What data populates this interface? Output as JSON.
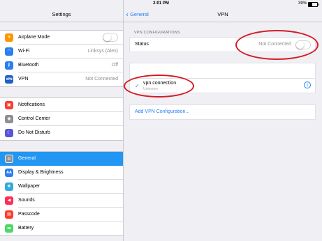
{
  "status_bar": {
    "device": "iPad",
    "time": "2:01 PM",
    "battery": "39%",
    "battery_level": 0.39
  },
  "settings": {
    "title": "Settings",
    "groups": [
      [
        {
          "id": "airplane",
          "label": "Airplane Mode",
          "value": "",
          "toggle": true,
          "icon": "airplane-icon",
          "glyph": "✈",
          "color": "#ff9500"
        },
        {
          "id": "wifi",
          "label": "Wi-Fi",
          "value": "Linksys (Alex)",
          "icon": "wifi-icon",
          "glyph": "◠",
          "color": "#2a7ef2"
        },
        {
          "id": "bluetooth",
          "label": "Bluetooth",
          "value": "Off",
          "icon": "bluetooth-icon",
          "glyph": "ᛒ",
          "color": "#2a7ef2"
        },
        {
          "id": "vpn",
          "label": "VPN",
          "value": "Not Connected",
          "icon": "vpn-icon",
          "glyph": "VPN",
          "color": "#1e5fc6"
        }
      ],
      [
        {
          "id": "notifications",
          "label": "Notifications",
          "value": "",
          "icon": "notifications-icon",
          "glyph": "▣",
          "color": "#ff3b30"
        },
        {
          "id": "control-center",
          "label": "Control Center",
          "value": "",
          "icon": "control-center-icon",
          "glyph": "◉",
          "color": "#8e8e93"
        },
        {
          "id": "do-not-disturb",
          "label": "Do Not Disturb",
          "value": "",
          "icon": "moon-icon",
          "glyph": "☾",
          "color": "#5856d6"
        }
      ],
      [
        {
          "id": "general",
          "label": "General",
          "value": "",
          "icon": "gear-icon",
          "glyph": "⚙",
          "color": "#8e8e93",
          "selected": true
        },
        {
          "id": "display",
          "label": "Display & Brightness",
          "value": "",
          "icon": "display-brightness-icon",
          "glyph": "AA",
          "color": "#2a7ef2"
        },
        {
          "id": "wallpaper",
          "label": "Wallpaper",
          "value": "",
          "icon": "wallpaper-icon",
          "glyph": "❀",
          "color": "#34aadc"
        },
        {
          "id": "sounds",
          "label": "Sounds",
          "value": "",
          "icon": "speaker-icon",
          "glyph": "◀",
          "color": "#ff2d55"
        },
        {
          "id": "passcode",
          "label": "Passcode",
          "value": "",
          "icon": "lock-icon",
          "glyph": "▤",
          "color": "#ff3b30"
        },
        {
          "id": "battery",
          "label": "Battery",
          "value": "",
          "icon": "battery-icon",
          "glyph": "▬",
          "color": "#4cd964"
        }
      ]
    ]
  },
  "vpn_page": {
    "back_label": "General",
    "title": "VPN",
    "section_header": "VPN CONFIGURATIONS",
    "status_label": "Status",
    "status_value": "Not Connected",
    "connection_name": "vpn connection",
    "connection_sub": "Unknown",
    "add_label": "Add VPN Configuration..."
  },
  "colors": {
    "accent": "#2a7ef2",
    "selected_row": "#2196f3",
    "annotation": "#d41b24"
  }
}
